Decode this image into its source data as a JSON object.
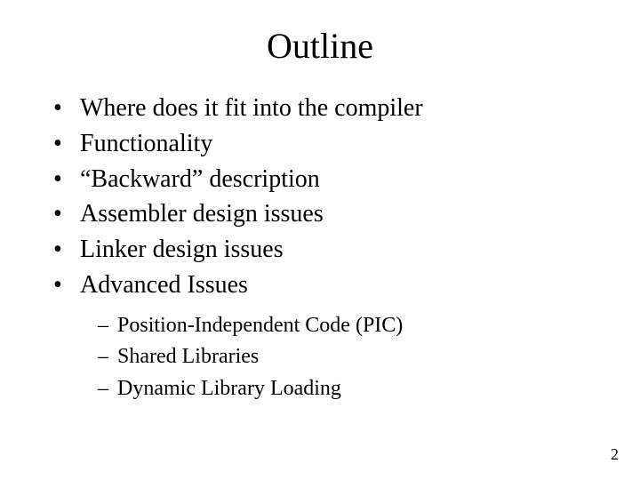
{
  "title": "Outline",
  "bullets": [
    "Where does it fit into the compiler",
    "Functionality",
    "“Backward” description",
    "Assembler design issues",
    "Linker design issues",
    "Advanced Issues"
  ],
  "sub_bullets": [
    "Position-Independent Code (PIC)",
    "Shared Libraries",
    "Dynamic Library Loading"
  ],
  "page_number": "2"
}
